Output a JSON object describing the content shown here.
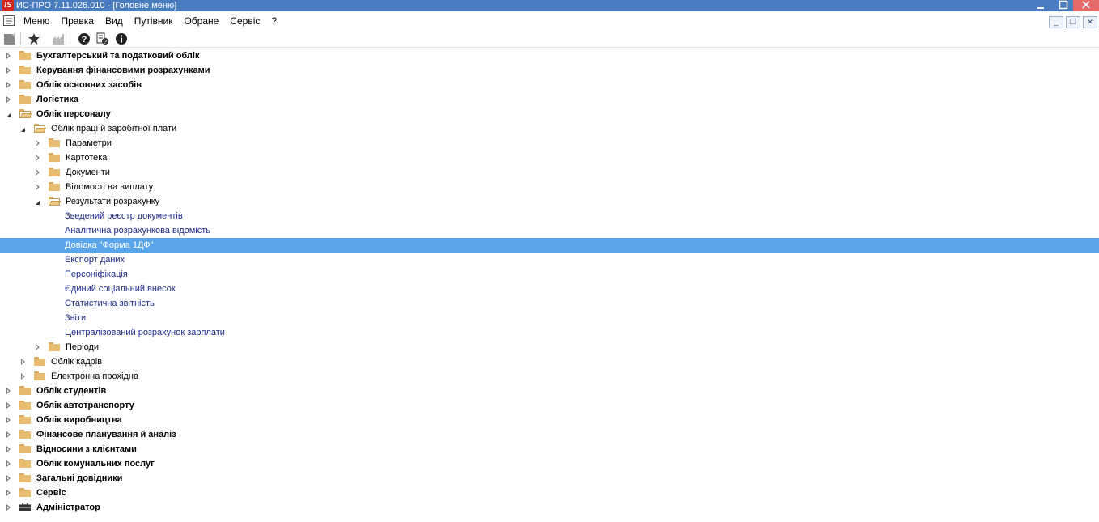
{
  "window": {
    "logo_text": "IS",
    "title": "ИС-ПРО 7.11.026.010 - [Головне меню]"
  },
  "menu": {
    "items": [
      "Меню",
      "Правка",
      "Вид",
      "Путівник",
      "Обране",
      "Сервіс",
      "?"
    ]
  },
  "toolbar": {
    "icons": [
      "document-icon",
      "star-icon",
      "factory-icon",
      "help-icon",
      "doc-help-icon",
      "info-icon"
    ]
  },
  "tree": [
    {
      "label": "Бухгалтерський та податковий облік",
      "level": 0,
      "state": "collapsed",
      "icon": "folder",
      "bold": true
    },
    {
      "label": "Керування фінансовими розрахунками",
      "level": 0,
      "state": "collapsed",
      "icon": "folder",
      "bold": true
    },
    {
      "label": "Облік основних засобів",
      "level": 0,
      "state": "collapsed",
      "icon": "folder",
      "bold": true
    },
    {
      "label": "Логістика",
      "level": 0,
      "state": "collapsed",
      "icon": "folder",
      "bold": true
    },
    {
      "label": "Облік персоналу",
      "level": 0,
      "state": "expanded",
      "icon": "folder-open",
      "bold": true
    },
    {
      "label": "Облік праці й заробітної плати",
      "level": 1,
      "state": "expanded",
      "icon": "folder-open"
    },
    {
      "label": "Параметри",
      "level": 2,
      "state": "collapsed",
      "icon": "folder"
    },
    {
      "label": "Картотека",
      "level": 2,
      "state": "collapsed",
      "icon": "folder"
    },
    {
      "label": "Документи",
      "level": 2,
      "state": "collapsed",
      "icon": "folder"
    },
    {
      "label": "Відомості на виплату",
      "level": 2,
      "state": "collapsed",
      "icon": "folder"
    },
    {
      "label": "Результати розрахунку",
      "level": 2,
      "state": "expanded",
      "icon": "folder-open"
    },
    {
      "label": "Зведений реєстр документів",
      "level": 3,
      "state": "leaf"
    },
    {
      "label": "Аналітична розрахункова відомість",
      "level": 3,
      "state": "leaf"
    },
    {
      "label": "Довідка \"Форма 1ДФ\"",
      "level": 3,
      "state": "leaf",
      "selected": true
    },
    {
      "label": "Експорт даних",
      "level": 3,
      "state": "leaf"
    },
    {
      "label": "Персоніфікація",
      "level": 3,
      "state": "leaf"
    },
    {
      "label": "Єдиний соціальний внесок",
      "level": 3,
      "state": "leaf"
    },
    {
      "label": "Статистична звітність",
      "level": 3,
      "state": "leaf"
    },
    {
      "label": "Звіти",
      "level": 3,
      "state": "leaf"
    },
    {
      "label": "Централізований розрахунок зарплати",
      "level": 3,
      "state": "leaf"
    },
    {
      "label": "Періоди",
      "level": 2,
      "state": "collapsed",
      "icon": "folder"
    },
    {
      "label": "Облік кадрів",
      "level": 1,
      "state": "collapsed",
      "icon": "folder"
    },
    {
      "label": "Електронна прохідна",
      "level": 1,
      "state": "collapsed",
      "icon": "folder"
    },
    {
      "label": "Облік студентів",
      "level": 0,
      "state": "collapsed",
      "icon": "folder",
      "bold": true
    },
    {
      "label": "Облік автотранспорту",
      "level": 0,
      "state": "collapsed",
      "icon": "folder",
      "bold": true
    },
    {
      "label": "Облік виробництва",
      "level": 0,
      "state": "collapsed",
      "icon": "folder",
      "bold": true
    },
    {
      "label": "Фінансове планування й аналіз",
      "level": 0,
      "state": "collapsed",
      "icon": "folder",
      "bold": true
    },
    {
      "label": "Відносини з клієнтами",
      "level": 0,
      "state": "collapsed",
      "icon": "folder",
      "bold": true
    },
    {
      "label": "Облік комунальних послуг",
      "level": 0,
      "state": "collapsed",
      "icon": "folder",
      "bold": true
    },
    {
      "label": "Загальні довідники",
      "level": 0,
      "state": "collapsed",
      "icon": "folder",
      "bold": true
    },
    {
      "label": "Сервіс",
      "level": 0,
      "state": "collapsed",
      "icon": "folder",
      "bold": true
    },
    {
      "label": "Адміністратор",
      "level": 0,
      "state": "collapsed",
      "icon": "briefcase",
      "bold": true
    }
  ]
}
